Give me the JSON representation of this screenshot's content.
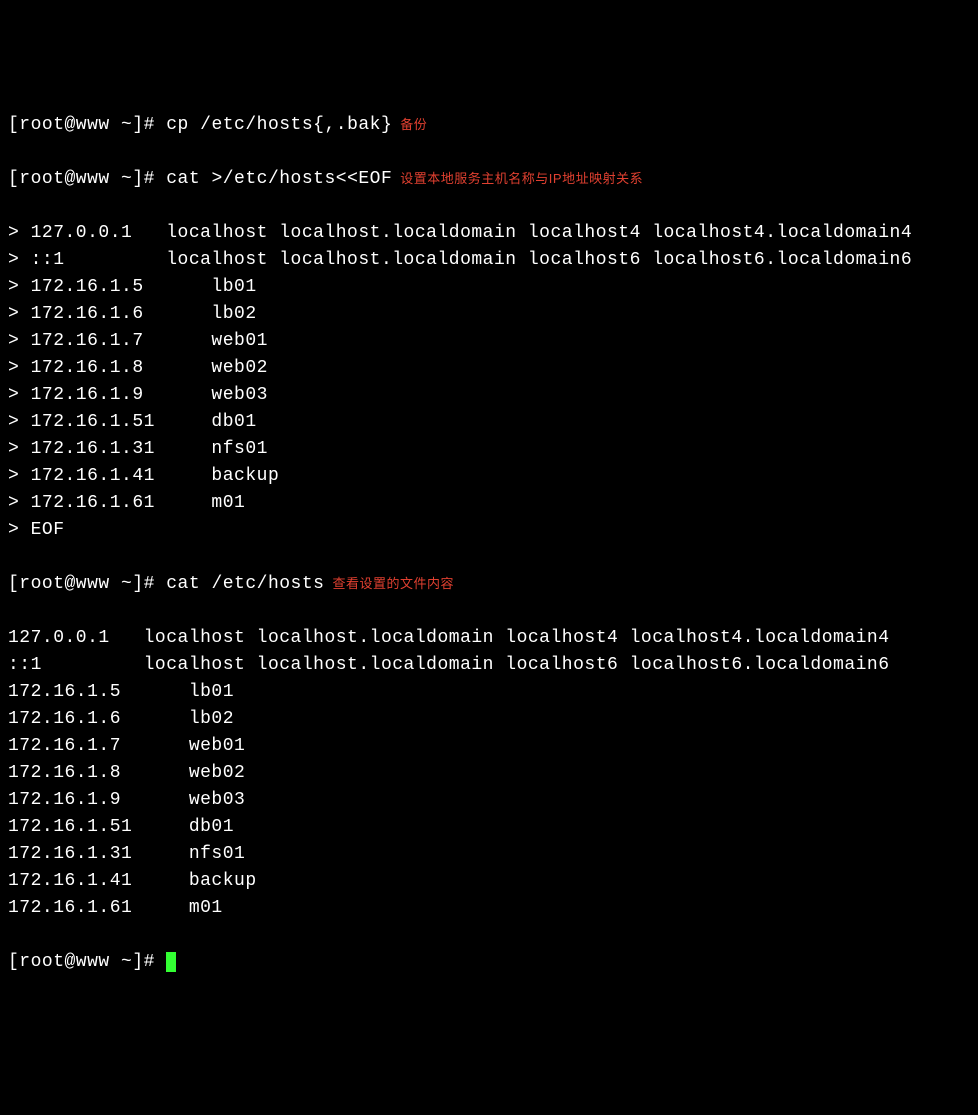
{
  "prompt": "[root@www ~]# ",
  "heredoc_prefix": "> ",
  "cmd1": "cp /etc/hosts{,.bak}",
  "anno1": "备份",
  "cmd2": "cat >/etc/hosts<<EOF",
  "anno2": "设置本地服务主机名称与IP地址映射关系",
  "heredoc_lines": [
    "127.0.0.1   localhost localhost.localdomain localhost4 localhost4.localdomain4",
    "::1         localhost localhost.localdomain localhost6 localhost6.localdomain6",
    "172.16.1.5      lb01",
    "172.16.1.6      lb02",
    "172.16.1.7      web01",
    "172.16.1.8      web02",
    "172.16.1.9      web03",
    "172.16.1.51     db01",
    "172.16.1.31     nfs01",
    "172.16.1.41     backup",
    "172.16.1.61     m01",
    "EOF"
  ],
  "cmd3": "cat /etc/hosts",
  "anno3": "查看设置的文件内容",
  "output_lines": [
    "127.0.0.1   localhost localhost.localdomain localhost4 localhost4.localdomain4",
    "::1         localhost localhost.localdomain localhost6 localhost6.localdomain6",
    "172.16.1.5      lb01",
    "172.16.1.6      lb02",
    "172.16.1.7      web01",
    "172.16.1.8      web02",
    "172.16.1.9      web03",
    "172.16.1.51     db01",
    "172.16.1.31     nfs01",
    "172.16.1.41     backup",
    "172.16.1.61     m01"
  ]
}
